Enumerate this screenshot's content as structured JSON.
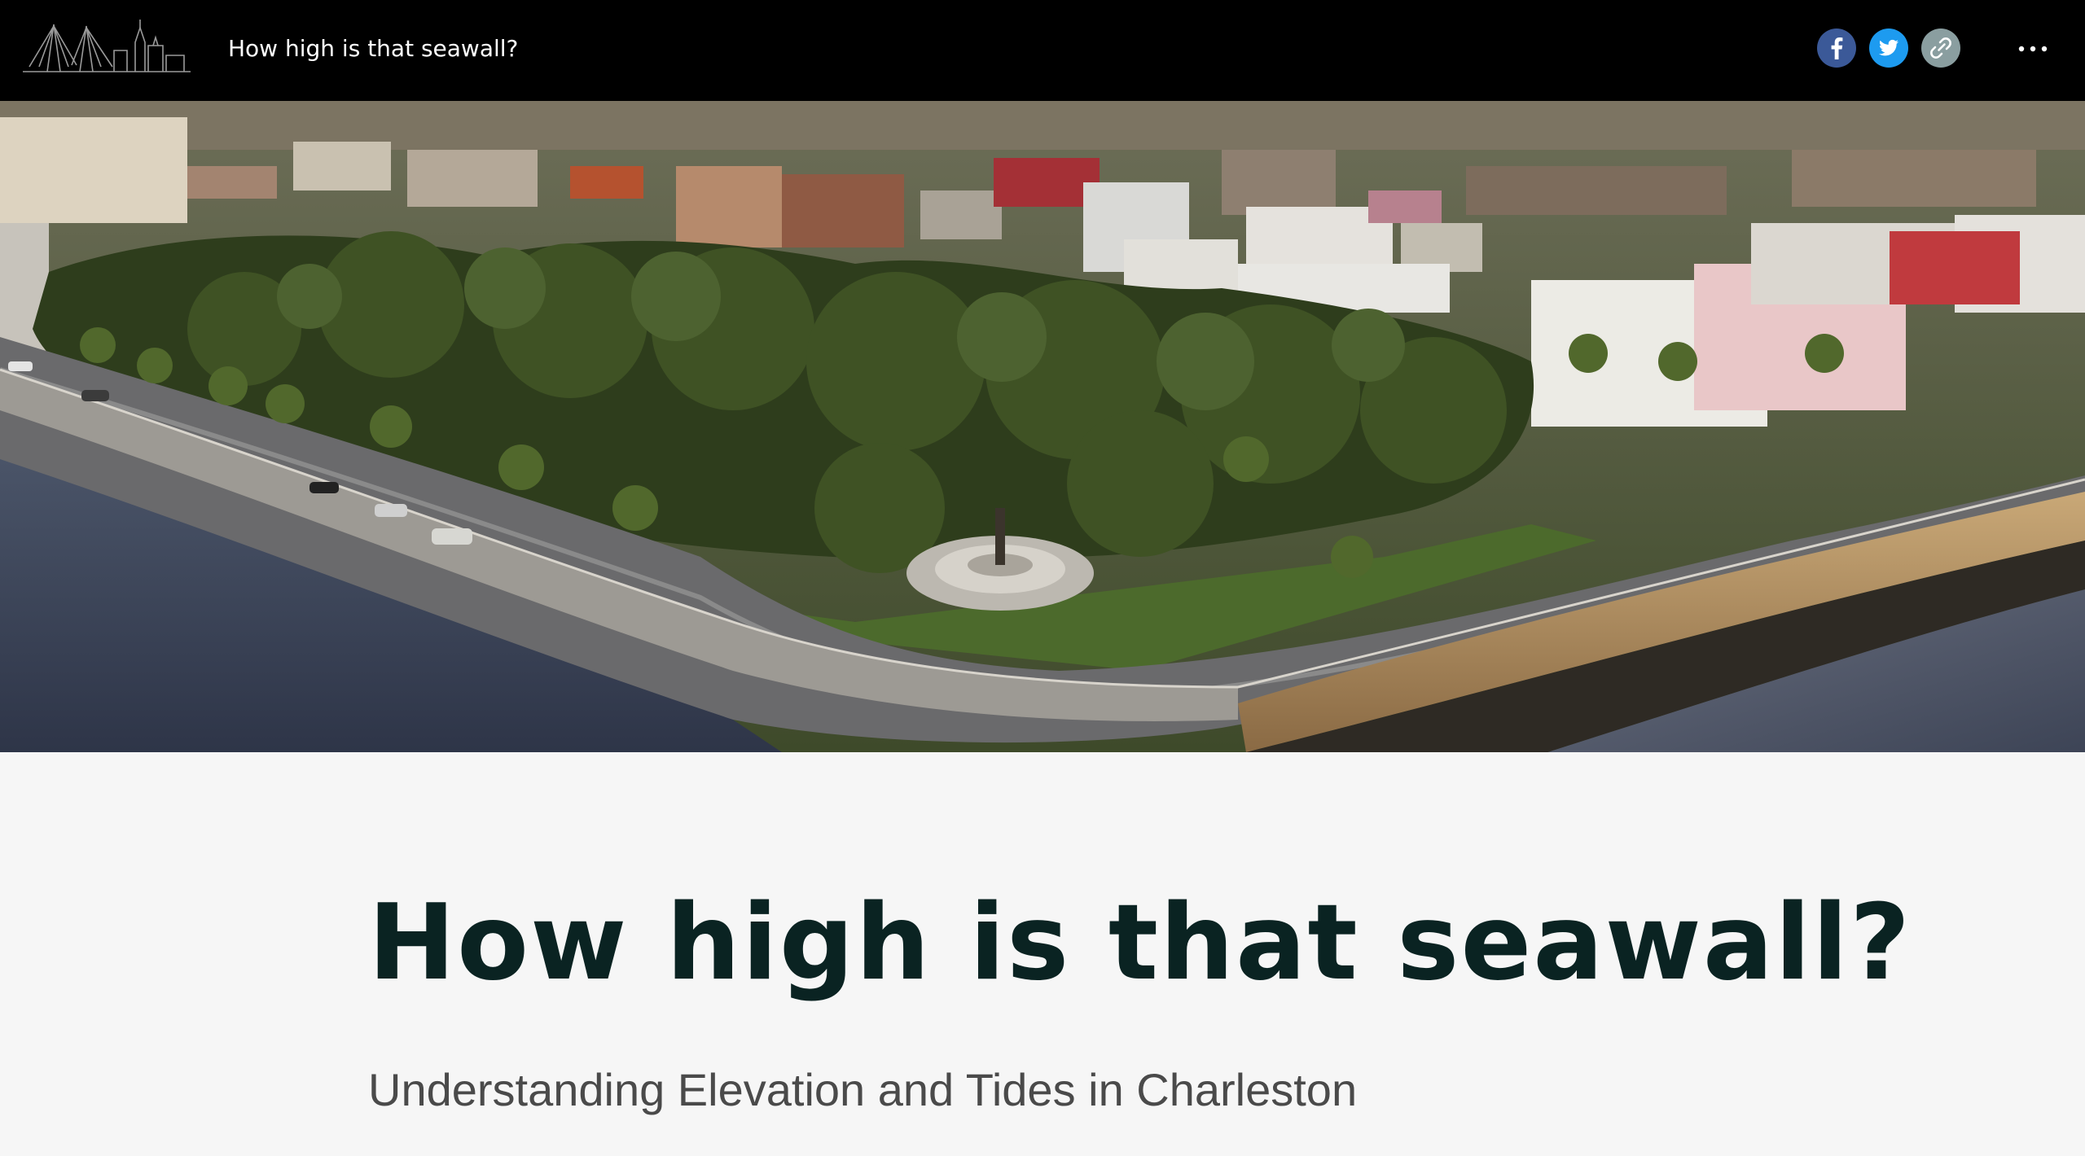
{
  "header": {
    "title": "How high is that seawall?",
    "logo_icon": "charleston-skyline-logo",
    "share": {
      "facebook_icon": "facebook-icon",
      "twitter_icon": "twitter-icon",
      "link_icon": "link-icon"
    },
    "more_icon": "more-options-icon"
  },
  "hero": {
    "image": "aerial-photo-charleston-battery-seawall"
  },
  "story": {
    "title": "How high is that seawall?",
    "subtitle": "Understanding Elevation and Tides in Charleston"
  },
  "colors": {
    "header_bg": "#000000",
    "title_color": "#0a2322",
    "subtitle_color": "#4a4a4a",
    "page_bg": "#f6f6f6",
    "facebook": "#3b5998",
    "twitter": "#1d9bf0",
    "link": "#8a9ea0"
  }
}
